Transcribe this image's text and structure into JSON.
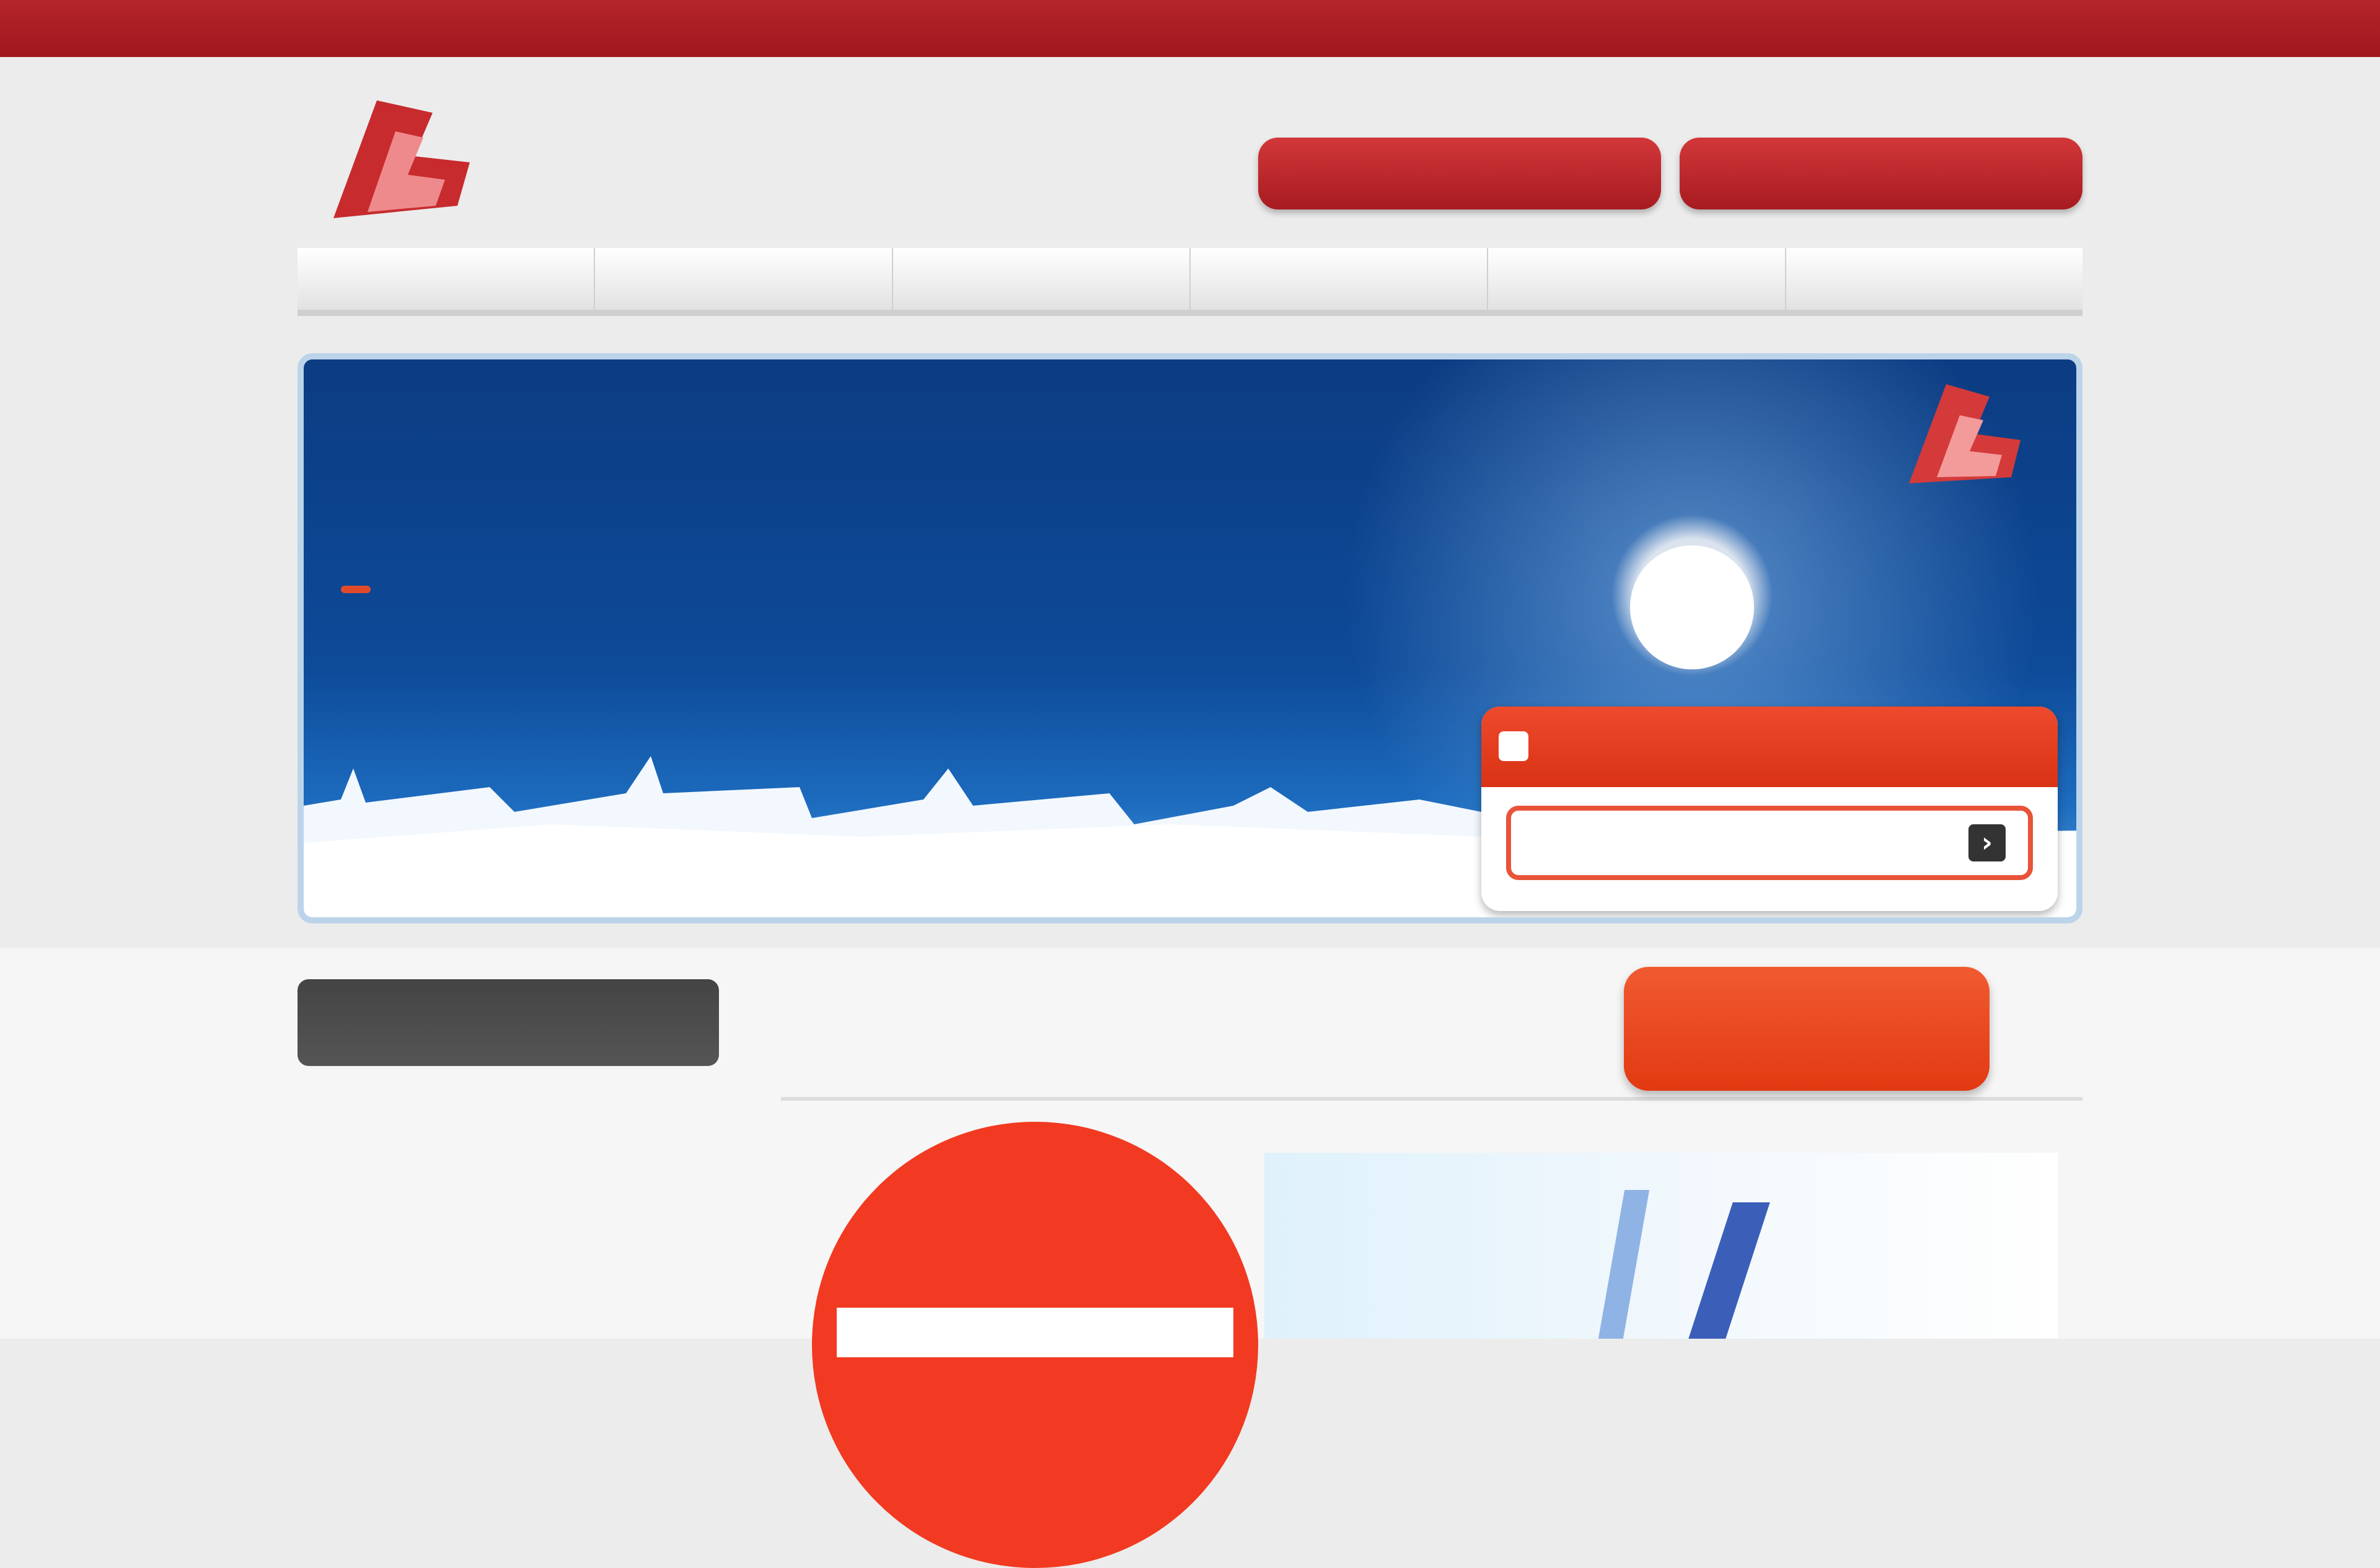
{
  "colors": {
    "brand_red": "#a0161d",
    "banner_blue": "#0d4a98",
    "accent_orange": "#e23a12"
  },
  "topbar": {
    "link_label": ""
  },
  "header": {
    "brand_name": "",
    "brand_sub": "",
    "buttons": [
      "",
      ""
    ]
  },
  "nav": {
    "items": [
      "",
      "",
      "",
      "",
      "",
      ""
    ]
  },
  "banner": {
    "line1_a": "",
    "line1_em": "",
    "line1_b": "",
    "line1_em2": "",
    "line1_c": "",
    "line2": "",
    "line3_tag": "",
    "line3": "",
    "line4": "",
    "line5": "",
    "cta_top": "",
    "cta_bottom": "",
    "cta_arrow": "›",
    "cta_note": ""
  },
  "sidebar": {
    "head": "",
    "rows": [
      {
        "k": "",
        "v": ""
      },
      {
        "k": "",
        "v": ""
      }
    ]
  },
  "main": {
    "heading": "",
    "red_button": "",
    "circle_text": ""
  }
}
